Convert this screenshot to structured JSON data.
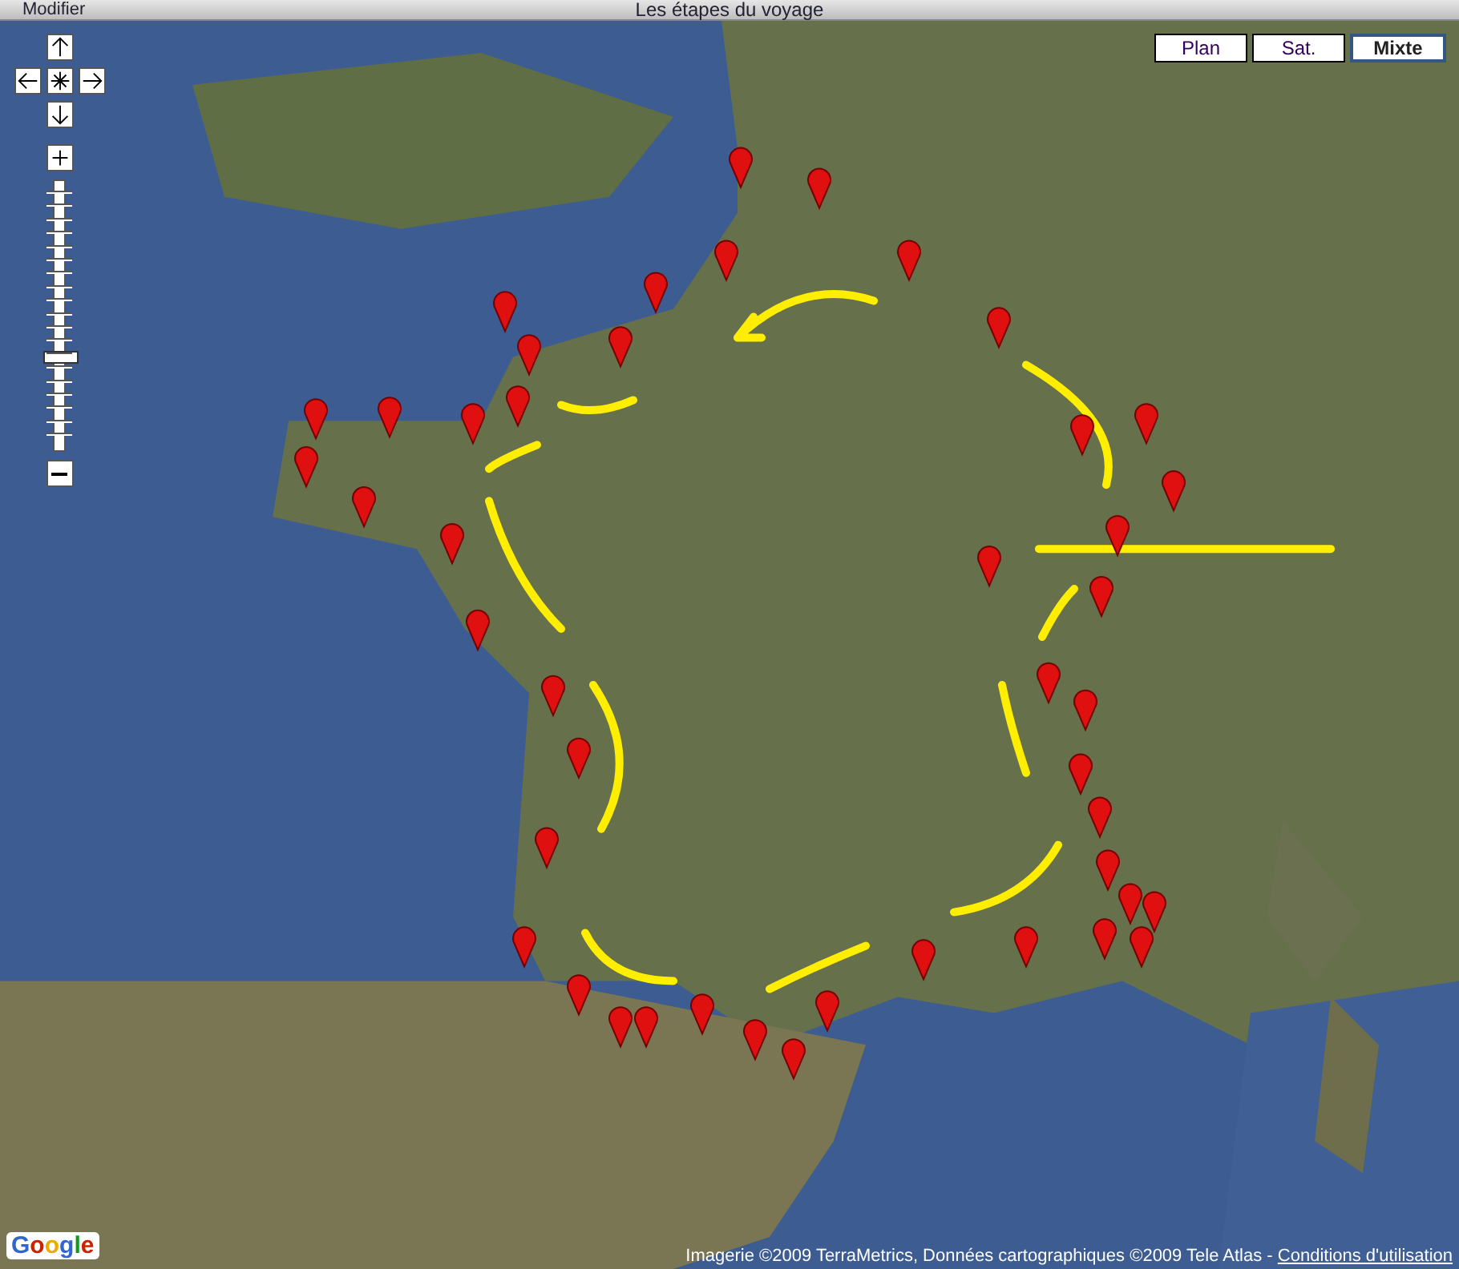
{
  "window": {
    "title": "Les étapes du voyage",
    "edit_link": "Modifier"
  },
  "map": {
    "map_types": [
      {
        "label": "Plan",
        "selected": false
      },
      {
        "label": "Sat.",
        "selected": false
      },
      {
        "label": "Mixte",
        "selected": true
      }
    ],
    "zoom": {
      "level": 0.34
    },
    "logo": "Google",
    "attribution": "Imagerie ©2009 TerraMetrics, Données cartographiques ©2009 Tele Atlas -",
    "terms_link": "Conditions d'utilisation"
  }
}
